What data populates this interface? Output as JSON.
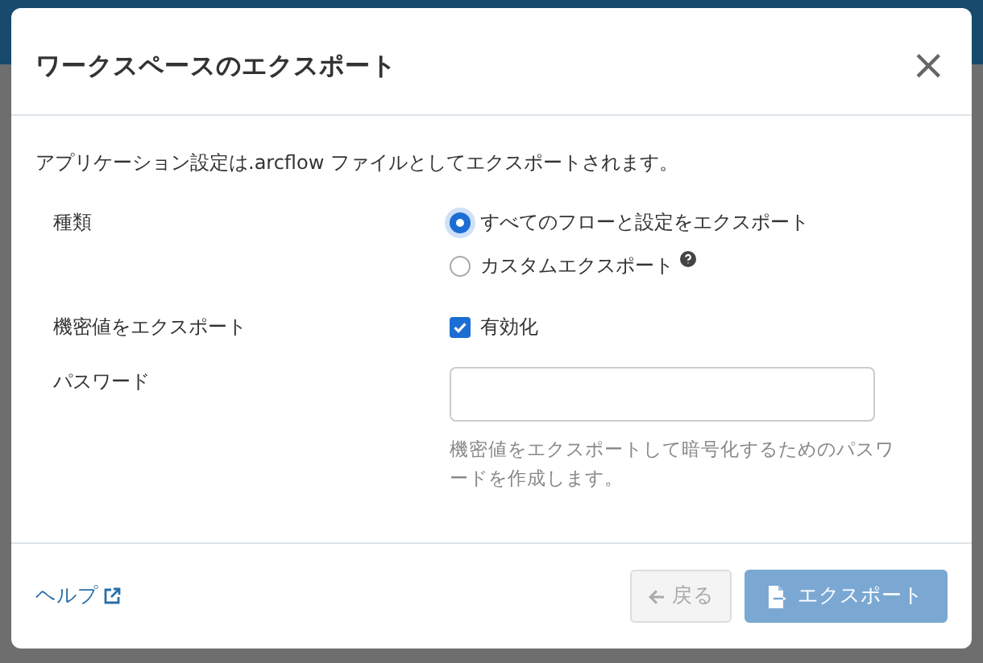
{
  "dialog": {
    "title": "ワークスペースのエクスポート",
    "close": "×"
  },
  "description": "アプリケーション設定は.arcflow ファイルとしてエクスポートされます。",
  "fields": [
    {
      "kind": "radio",
      "label": "種類",
      "options": [
        {
          "label": "すべてのフローと設定をエクスポート",
          "selected": true,
          "help_icon": false
        },
        {
          "label": "カスタムエクスポート",
          "selected": false,
          "help_icon": true
        }
      ]
    },
    {
      "kind": "checkbox",
      "label": "機密値をエクスポート",
      "option": {
        "label": "有効化",
        "checked": true
      }
    },
    {
      "kind": "password",
      "label": "パスワード",
      "help_text": "機密値をエクスポートして暗号化するためのパスワードを作成します。"
    }
  ],
  "footer": {
    "help_link": "ヘルプ",
    "buttons": [
      {
        "kind": "back",
        "label": "戻る",
        "disabled": true
      },
      {
        "kind": "export",
        "label": "エクスポート",
        "disabled": true
      }
    ]
  }
}
